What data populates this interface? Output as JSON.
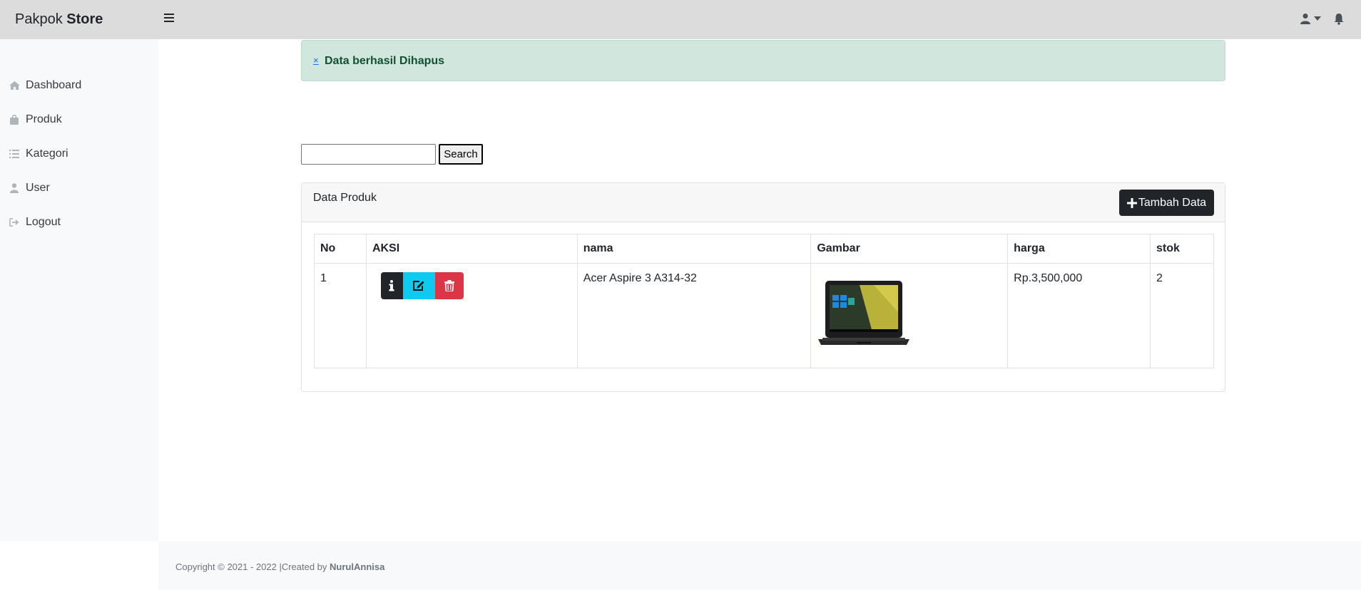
{
  "brand": {
    "name_regular": "Pakpok",
    "name_bold": "Store"
  },
  "sidebar": {
    "items": [
      {
        "label": "Dashboard",
        "icon": "home-icon"
      },
      {
        "label": "Produk",
        "icon": "bag-icon"
      },
      {
        "label": "Kategori",
        "icon": "list-icon"
      },
      {
        "label": "User",
        "icon": "user-icon"
      },
      {
        "label": "Logout",
        "icon": "logout-icon"
      }
    ]
  },
  "alert": {
    "close": "×",
    "message": "Data berhasil Dihapus"
  },
  "search": {
    "button_label": "Search",
    "value": ""
  },
  "card": {
    "title": "Data Produk",
    "add_button_label": "Tambah Data"
  },
  "table": {
    "headers": [
      "No",
      "AKSI",
      "nama",
      "Gambar",
      "harga",
      "stok"
    ],
    "rows": [
      {
        "no": "1",
        "nama": "Acer Aspire 3 A314-32",
        "harga": "Rp.3,500,000",
        "stok": "2",
        "image": "laptop-image"
      }
    ]
  },
  "footer": {
    "text": "Copyright © 2021 - 2022 |Created by",
    "author": "NurulAnnisa"
  },
  "colors": {
    "topbar": "#dcdcdc",
    "sidebar": "#f8f9fa",
    "alert_bg": "#d1e7dd",
    "alert_text": "#0f5132",
    "dark_button": "#212529",
    "info_button": "#0dcaf0",
    "danger_button": "#dc3545"
  }
}
